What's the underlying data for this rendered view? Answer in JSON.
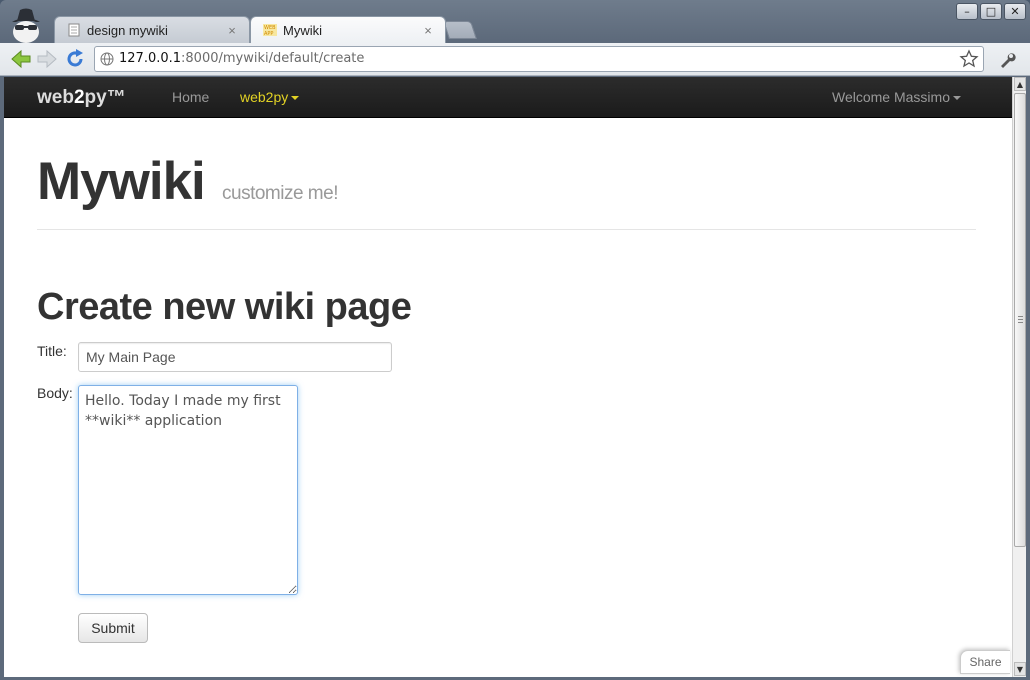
{
  "browser": {
    "tabs": [
      {
        "title": "design mywiki",
        "close": "×"
      },
      {
        "title": "Mywiki",
        "close": "×"
      }
    ],
    "url_host": "127.0.0.1",
    "url_rest": ":8000/mywiki/default/create",
    "window_buttons": {
      "minimize": "–",
      "maximize": "□",
      "close": "✕"
    }
  },
  "navbar": {
    "brand_main": "web",
    "brand_bold": "2",
    "brand_tail": "py™",
    "home": "Home",
    "web2py_menu": "web2py",
    "user_menu": "Welcome Massimo"
  },
  "header": {
    "title": "Mywiki",
    "subtitle": "customize me!"
  },
  "form": {
    "heading": "Create new wiki page",
    "title_label": "Title:",
    "title_value": "My Main Page",
    "body_label": "Body:",
    "body_value": "Hello. Today I made my first **wiki** application",
    "submit_label": "Submit"
  },
  "share": {
    "label": "Share"
  },
  "colors": {
    "navbar_bg": "#1b1b1b",
    "active_menu": "#e2d224",
    "focus_border": "#7fb0e6"
  }
}
